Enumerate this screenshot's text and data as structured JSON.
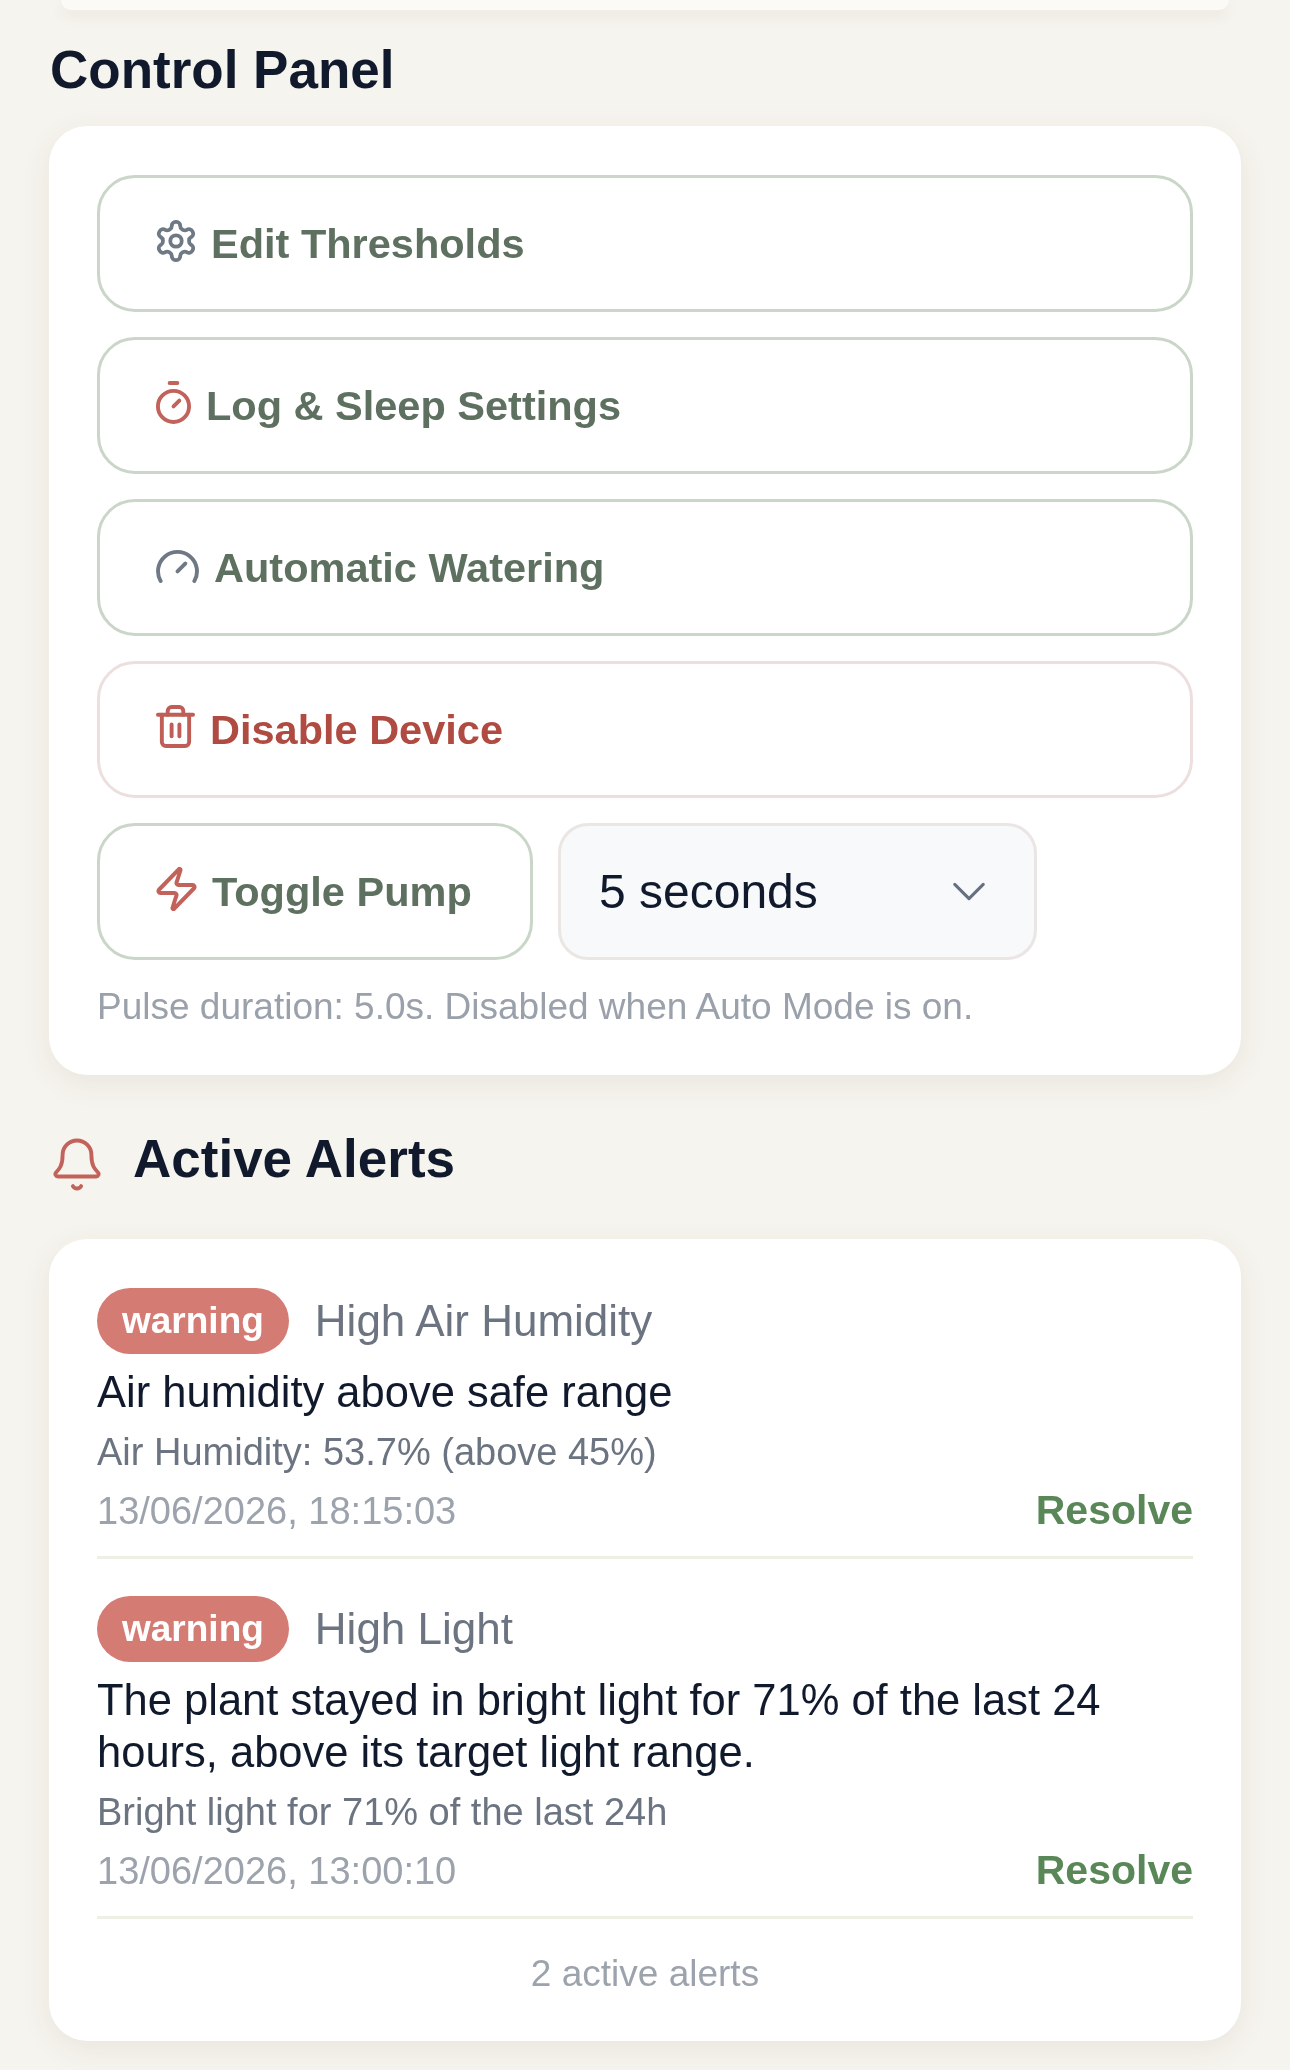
{
  "control_panel": {
    "title": "Control Panel",
    "actions": [
      {
        "label": "Edit Thresholds",
        "kind": "default"
      },
      {
        "label": "Log & Sleep Settings",
        "kind": "default"
      },
      {
        "label": "Automatic Watering",
        "kind": "default"
      },
      {
        "label": "Disable Device",
        "kind": "danger"
      }
    ],
    "pump_button": {
      "label": "Toggle Pump"
    },
    "duration_select": {
      "value": "5 seconds"
    },
    "hint": "Pulse duration: 5.0s. Disabled when Auto Mode is on."
  },
  "alerts": {
    "title": "Active Alerts",
    "items": [
      {
        "severity": "warning",
        "title": "High Air Humidity",
        "message": "Air humidity above safe range",
        "detail": "Air Humidity: 53.7% (above 45%)",
        "time": "13/06/2026, 18:15:03",
        "action": "Resolve"
      },
      {
        "severity": "warning",
        "title": "High Light",
        "message": "The plant stayed in bright light for 71% of the last 24 hours, above its target light range.",
        "detail": "Bright light for 71% of the last 24h",
        "time": "13/06/2026, 13:00:10",
        "action": "Resolve"
      }
    ],
    "footer": "2 active alerts"
  }
}
